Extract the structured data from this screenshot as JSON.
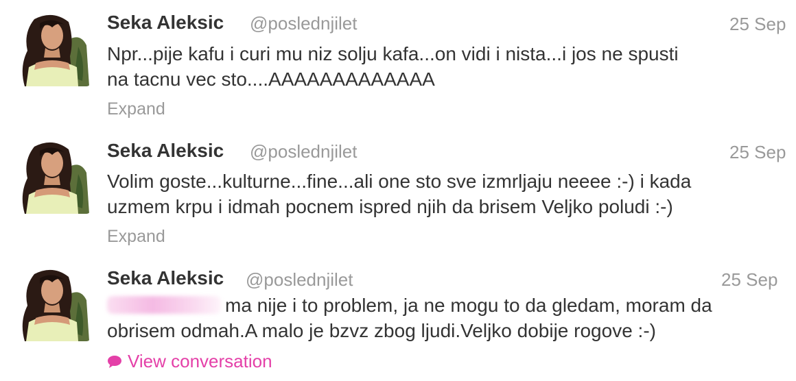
{
  "tweets": [
    {
      "name": "Seka Aleksic",
      "handle": "@poslednjilet",
      "time": "25 Sep",
      "lines": [
        "Npr...pije kafu i curi mu niz solju kafa...on vidi i nista...i jos ne spusti",
        "na tacnu vec sto....AAAAAAAAAAAAA"
      ],
      "action": "Expand"
    },
    {
      "name": "Seka Aleksic",
      "handle": "@poslednjilet",
      "time": "25 Sep",
      "lines": [
        "Volim goste...kulturne...fine...ali one sto sve izmrljaju neeee :-) i kada",
        "uzmem krpu i idmah pocnem ispred njih da brisem Veljko poludi :-)"
      ],
      "action": "Expand"
    },
    {
      "name": "Seka Aleksic",
      "handle": "@poslednjilet",
      "time": "25 Sep",
      "lines": [
        "ma nije i to problem, ja ne mogu to da gledam, moram da",
        "obrisem odmah.A malo je bzvz zbog ljudi.Veljko dobije rogove :-)"
      ],
      "action": "View conversation",
      "action_icon": "speech-bubble-icon",
      "accent_color": "#e440a8"
    }
  ]
}
